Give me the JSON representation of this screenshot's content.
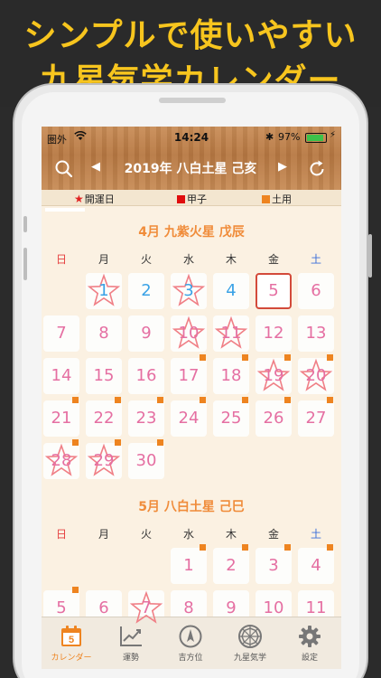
{
  "promo": {
    "line1": "シンプルで使いやすい",
    "line2": "九星気学カレンダー"
  },
  "status_bar": {
    "carrier": "圏外",
    "time": "14:24",
    "battery": "97%"
  },
  "nav": {
    "prev": "◀",
    "title": "2019年 八白土星 己亥",
    "next": "▶"
  },
  "legend": {
    "lucky_day": "開運日",
    "kinoene": "甲子",
    "doyo": "土用"
  },
  "colors": {
    "accent": "#ee8420",
    "day_pink": "#e56fa2",
    "day_blue": "#3aa2e6",
    "today_border": "#d34a3a"
  },
  "weekdays": [
    "日",
    "月",
    "火",
    "水",
    "木",
    "金",
    "土"
  ],
  "months": [
    {
      "title": "4月 九紫火星 戊辰",
      "days": [
        {
          "d": "1",
          "col": 1,
          "row": 0,
          "star": true,
          "blue": true
        },
        {
          "d": "2",
          "col": 2,
          "row": 0,
          "blue": true
        },
        {
          "d": "3",
          "col": 3,
          "row": 0,
          "star": true,
          "blue": true
        },
        {
          "d": "4",
          "col": 4,
          "row": 0,
          "blue": true
        },
        {
          "d": "5",
          "col": 5,
          "row": 0,
          "today": true
        },
        {
          "d": "6",
          "col": 6,
          "row": 0
        },
        {
          "d": "7",
          "col": 0,
          "row": 1
        },
        {
          "d": "8",
          "col": 1,
          "row": 1
        },
        {
          "d": "9",
          "col": 2,
          "row": 1
        },
        {
          "d": "10",
          "col": 3,
          "row": 1,
          "star": true
        },
        {
          "d": "11",
          "col": 4,
          "row": 1,
          "star": true
        },
        {
          "d": "12",
          "col": 5,
          "row": 1
        },
        {
          "d": "13",
          "col": 6,
          "row": 1
        },
        {
          "d": "14",
          "col": 0,
          "row": 2
        },
        {
          "d": "15",
          "col": 1,
          "row": 2
        },
        {
          "d": "16",
          "col": 2,
          "row": 2
        },
        {
          "d": "17",
          "col": 3,
          "row": 2,
          "doyo": true
        },
        {
          "d": "18",
          "col": 4,
          "row": 2,
          "doyo": true
        },
        {
          "d": "19",
          "col": 5,
          "row": 2,
          "star": true,
          "doyo": true
        },
        {
          "d": "20",
          "col": 6,
          "row": 2,
          "star": true,
          "doyo": true
        },
        {
          "d": "21",
          "col": 0,
          "row": 3,
          "doyo": true
        },
        {
          "d": "22",
          "col": 1,
          "row": 3,
          "doyo": true
        },
        {
          "d": "23",
          "col": 2,
          "row": 3,
          "doyo": true
        },
        {
          "d": "24",
          "col": 3,
          "row": 3,
          "doyo": true
        },
        {
          "d": "25",
          "col": 4,
          "row": 3,
          "doyo": true
        },
        {
          "d": "26",
          "col": 5,
          "row": 3,
          "doyo": true
        },
        {
          "d": "27",
          "col": 6,
          "row": 3,
          "doyo": true
        },
        {
          "d": "28",
          "col": 0,
          "row": 4,
          "star": true,
          "doyo": true
        },
        {
          "d": "29",
          "col": 1,
          "row": 4,
          "star": true,
          "doyo": true
        },
        {
          "d": "30",
          "col": 2,
          "row": 4,
          "doyo": true
        }
      ]
    },
    {
      "title": "5月 八白土星 己巳",
      "days": [
        {
          "d": "1",
          "col": 3,
          "row": 0,
          "doyo": true
        },
        {
          "d": "2",
          "col": 4,
          "row": 0,
          "doyo": true
        },
        {
          "d": "3",
          "col": 5,
          "row": 0,
          "doyo": true
        },
        {
          "d": "4",
          "col": 6,
          "row": 0,
          "doyo": true
        },
        {
          "d": "5",
          "col": 0,
          "row": 1,
          "doyo": true
        },
        {
          "d": "6",
          "col": 1,
          "row": 1
        },
        {
          "d": "7",
          "col": 2,
          "row": 1,
          "star": true
        },
        {
          "d": "8",
          "col": 3,
          "row": 1
        },
        {
          "d": "9",
          "col": 4,
          "row": 1
        },
        {
          "d": "10",
          "col": 5,
          "row": 1
        },
        {
          "d": "11",
          "col": 6,
          "row": 1
        }
      ]
    }
  ],
  "tabs": [
    {
      "label": "カレンダー",
      "icon": "calendar-icon",
      "day": "5"
    },
    {
      "label": "運勢",
      "icon": "chart-icon"
    },
    {
      "label": "吉方位",
      "icon": "compass-icon"
    },
    {
      "label": "九星気学",
      "icon": "wheel-icon"
    },
    {
      "label": "設定",
      "icon": "gear-icon"
    }
  ]
}
